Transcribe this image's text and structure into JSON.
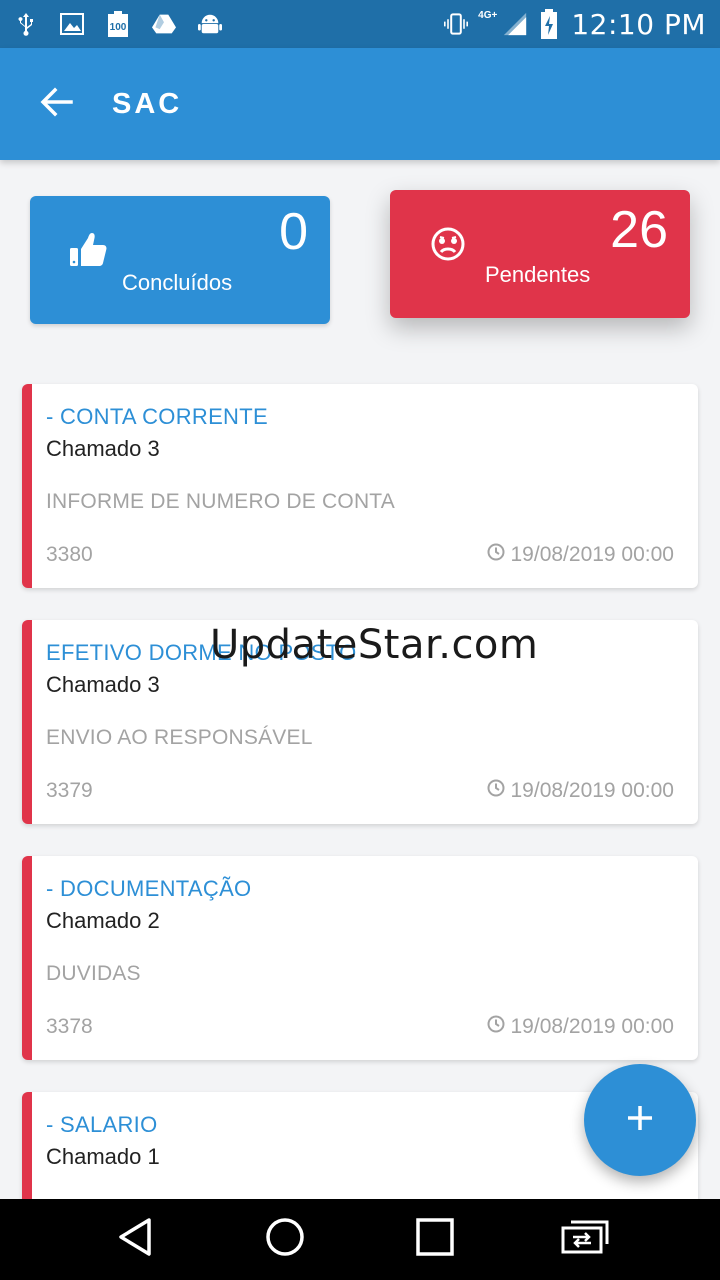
{
  "status_bar": {
    "time": "12:10 PM",
    "network": "4G+",
    "left_icons": [
      "usb-icon",
      "image-icon",
      "battery-100-icon",
      "drive-icon",
      "android-icon"
    ],
    "right_icons": [
      "vibrate-icon",
      "signal-icon",
      "battery-charging-icon"
    ]
  },
  "app_bar": {
    "title": "SAC",
    "back_icon": "arrow-back-icon"
  },
  "summary": {
    "done": {
      "count": "0",
      "label": "Concluídos",
      "icon": "thumbs-up-icon",
      "color": "#2d8fd6"
    },
    "pending": {
      "count": "26",
      "label": "Pendentes",
      "icon": "sad-face-icon",
      "color": "#e0344a"
    }
  },
  "tickets": [
    {
      "category": "- CONTA CORRENTE",
      "title": "Chamado 3",
      "description": "INFORME DE NUMERO DE CONTA",
      "id": "3380",
      "date": "19/08/2019 00:00"
    },
    {
      "category": "EFETIVO DORME NO POSTO",
      "title": "Chamado 3",
      "description": "ENVIO AO RESPONSÁVEL",
      "id": "3379",
      "date": "19/08/2019 00:00"
    },
    {
      "category": "- DOCUMENTAÇÃO",
      "title": "Chamado 2",
      "description": "DUVIDAS",
      "id": "3378",
      "date": "19/08/2019 00:00"
    },
    {
      "category": "- SALARIO",
      "title": "Chamado 1",
      "description": "",
      "id": "",
      "date": ""
    }
  ],
  "watermark": "UpdateStar.com",
  "fab": {
    "icon": "plus-icon"
  },
  "nav": [
    "back-triangle-icon",
    "home-circle-icon",
    "recents-square-icon",
    "screen-switch-icon"
  ],
  "colors": {
    "primary": "#2d8fd6",
    "status_bar": "#1f6fa8",
    "accent_red": "#e0344a"
  }
}
